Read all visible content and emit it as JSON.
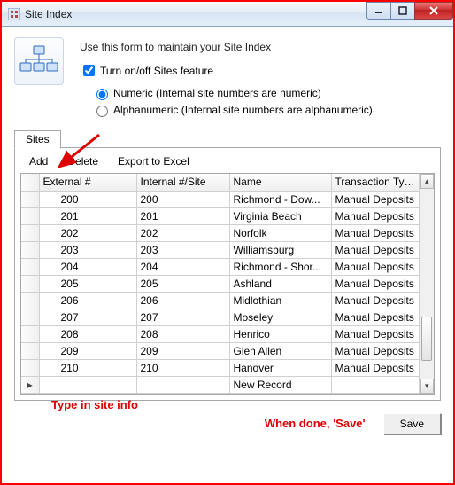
{
  "window": {
    "title": "Site Index"
  },
  "intro": "Use this form to maintain your Site Index",
  "feature_checkbox_label": "Turn on/off Sites feature",
  "feature_checked": true,
  "radio_numeric": "Numeric (Internal site numbers are numeric)",
  "radio_alpha": "Alphanumeric (Internal site numbers are alphanumeric)",
  "radio_selected": "numeric",
  "tab_label": "Sites",
  "toolbar": {
    "add": "Add",
    "delete": "Delete",
    "export": "Export to Excel"
  },
  "columns": {
    "external": "External #",
    "internal": "Internal #/Site",
    "name": "Name",
    "type": "Transaction Type"
  },
  "rows": [
    {
      "ext": "200",
      "int": "200",
      "name": "Richmond - Dow...",
      "type": "Manual Deposits"
    },
    {
      "ext": "201",
      "int": "201",
      "name": "Virginia Beach",
      "type": "Manual Deposits"
    },
    {
      "ext": "202",
      "int": "202",
      "name": "Norfolk",
      "type": "Manual Deposits"
    },
    {
      "ext": "203",
      "int": "203",
      "name": "Williamsburg",
      "type": "Manual Deposits"
    },
    {
      "ext": "204",
      "int": "204",
      "name": "Richmond - Shor...",
      "type": "Manual Deposits"
    },
    {
      "ext": "205",
      "int": "205",
      "name": "Ashland",
      "type": "Manual Deposits"
    },
    {
      "ext": "206",
      "int": "206",
      "name": "Midlothian",
      "type": "Manual Deposits"
    },
    {
      "ext": "207",
      "int": "207",
      "name": "Moseley",
      "type": "Manual Deposits"
    },
    {
      "ext": "208",
      "int": "208",
      "name": "Henrico",
      "type": "Manual Deposits"
    },
    {
      "ext": "209",
      "int": "209",
      "name": "Glen Allen",
      "type": "Manual Deposits"
    },
    {
      "ext": "210",
      "int": "210",
      "name": "Hanover",
      "type": "Manual Deposits"
    }
  ],
  "new_row_label": "New Record",
  "annot_type_in": "Type in site info",
  "annot_save": "When done, 'Save'",
  "save_btn": "Save"
}
